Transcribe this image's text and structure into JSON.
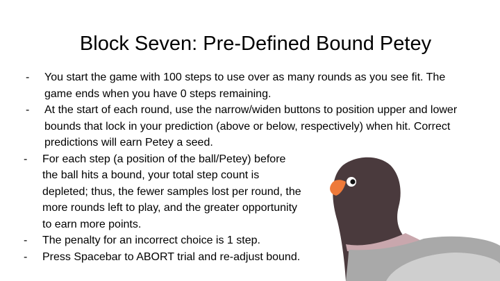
{
  "slide": {
    "title": "Block Seven: Pre-Defined Bound Petey",
    "bullet_marker": "-",
    "bullets": [
      {
        "lines": [
          "You start the game with 100 steps to use over as many rounds as you see fit. The",
          "game ends when you have 0 steps remaining."
        ]
      },
      {
        "lines": [
          "At the start of each round, use the narrow/widen buttons to position upper and lower",
          "bounds that lock in your prediction (above or below, respectively) when hit. Correct",
          "predictions will earn Petey a seed."
        ]
      },
      {
        "lines": [
          "For each step (a position of the ball/Petey) before",
          "the ball hits a bound, your total step count is",
          "depleted; thus, the fewer samples lost per round, the",
          "more rounds left to play, and the greater opportunity",
          "to earn more points."
        ]
      },
      {
        "lines": [
          "The penalty for an incorrect choice is 1 step."
        ]
      },
      {
        "lines": [
          "Press Spacebar to ABORT trial and re-adjust bound."
        ]
      }
    ]
  },
  "illustration": {
    "icon": "pigeon-icon",
    "colors": {
      "head": "#4a3a3d",
      "neck_band": "#c9a7ad",
      "body": "#a9a9a9",
      "wing": "#cfcfcf",
      "beak": "#ee7a3a",
      "eye": "#ffffff"
    }
  }
}
